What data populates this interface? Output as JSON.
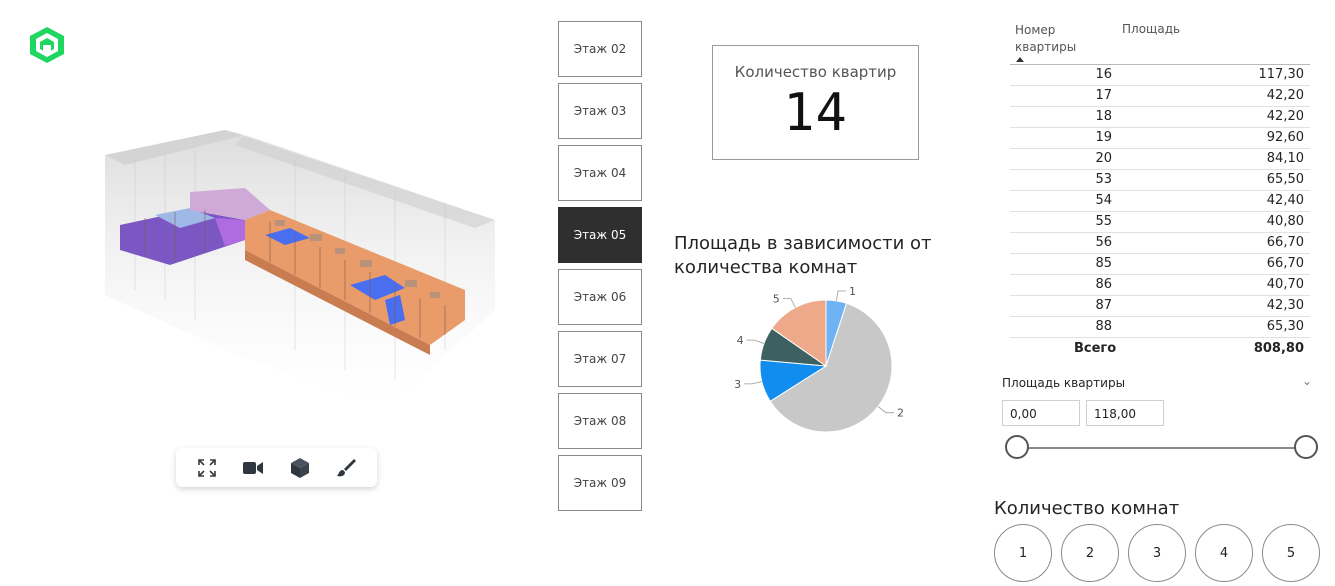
{
  "floors": [
    "Этаж 02",
    "Этаж 03",
    "Этаж 04",
    "Этаж 05",
    "Этаж 06",
    "Этаж 07",
    "Этаж 08",
    "Этаж 09"
  ],
  "active_floor": "Этаж 05",
  "card": {
    "label": "Количество квартир",
    "value": "14"
  },
  "pie": {
    "title": "Площадь в зависимости от количества комнат",
    "labels": [
      "1",
      "2",
      "3",
      "4",
      "5"
    ]
  },
  "chart_data": {
    "type": "pie",
    "title": "Площадь в зависимости от количества комнат",
    "categories": [
      "1",
      "2",
      "3",
      "4",
      "5"
    ],
    "values": [
      40.8,
      493.2,
      84.1,
      66.7,
      124.0
    ],
    "colors": [
      "#6fb3f5",
      "#c8c8c8",
      "#118df0",
      "#3d6161",
      "#eea88a"
    ]
  },
  "table": {
    "col1": "Номер квартиры",
    "col2": "Площадь",
    "rows": [
      [
        "16",
        "117,30"
      ],
      [
        "17",
        "42,20"
      ],
      [
        "18",
        "42,20"
      ],
      [
        "19",
        "92,60"
      ],
      [
        "20",
        "84,10"
      ],
      [
        "53",
        "65,50"
      ],
      [
        "54",
        "42,40"
      ],
      [
        "55",
        "40,80"
      ],
      [
        "56",
        "66,70"
      ],
      [
        "85",
        "66,70"
      ],
      [
        "86",
        "40,70"
      ],
      [
        "87",
        "42,30"
      ],
      [
        "88",
        "65,30"
      ]
    ],
    "total_label": "Всего",
    "total_value": "808,80"
  },
  "slicer": {
    "title": "Площадь квартиры",
    "min": "0,00",
    "max": "118,00"
  },
  "rooms": {
    "title": "Количество комнат",
    "options": [
      "1",
      "2",
      "3",
      "4",
      "5"
    ]
  },
  "toolbar": {
    "icons": [
      "fullscreen-icon",
      "camera-icon",
      "cube-icon",
      "brush-icon"
    ]
  },
  "colors": {
    "accent_logo": "#1fd760",
    "active_floor_bg": "#2f2f2f"
  }
}
